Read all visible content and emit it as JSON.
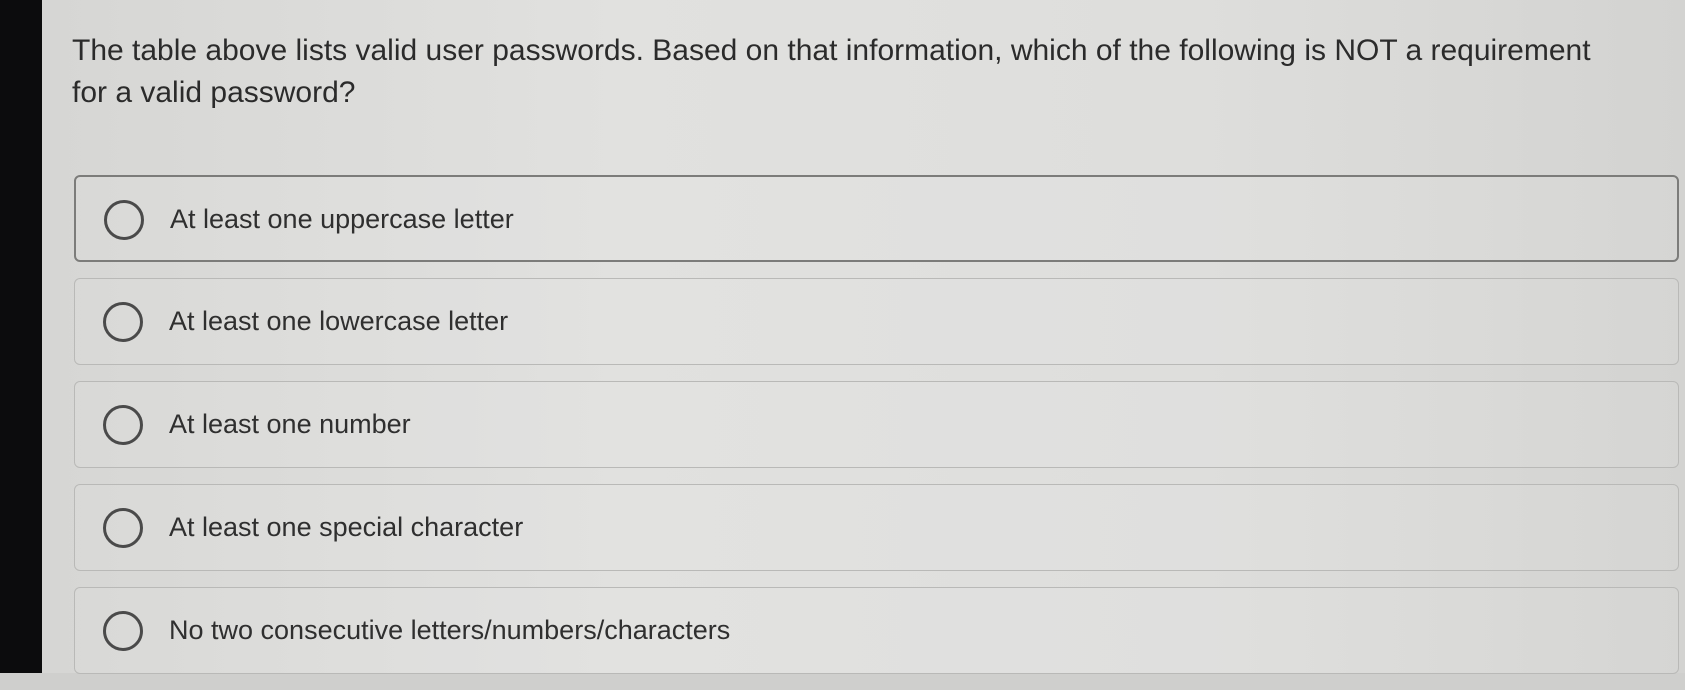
{
  "question": {
    "text": "The table above lists valid user passwords. Based on that information, which of the following is NOT a requirement for a valid password?"
  },
  "options": [
    {
      "label": "At least one uppercase letter",
      "selected": false
    },
    {
      "label": "At least one lowercase letter",
      "selected": false
    },
    {
      "label": "At least one number",
      "selected": false
    },
    {
      "label": "At least one special character",
      "selected": false
    },
    {
      "label": "No two consecutive letters/numbers/characters",
      "selected": false
    }
  ],
  "colors": {
    "text": "#2b2b2b",
    "border": "#b9b9b7",
    "background": "#e0e0de",
    "bezel": "#0c0c0d"
  }
}
